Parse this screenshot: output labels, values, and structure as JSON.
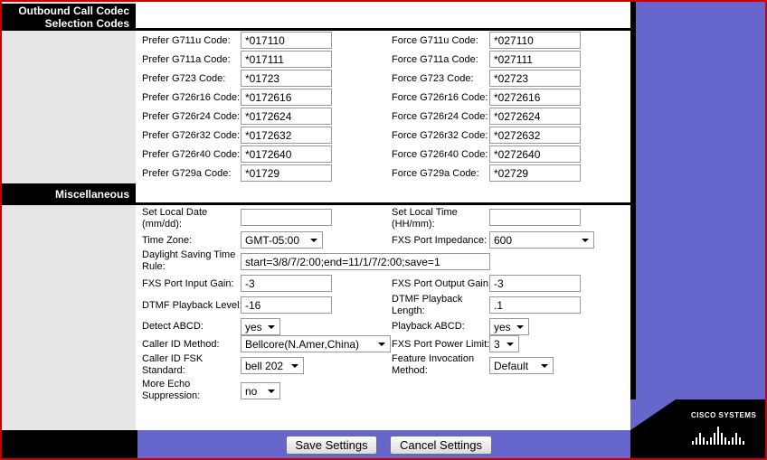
{
  "sections": {
    "codec_title_line1": "Outbound Call Codec",
    "codec_title_line2": "Selection Codes",
    "misc_title": "Miscellaneous"
  },
  "codec": {
    "prefer": [
      {
        "label": "Prefer G711u Code:",
        "value": "*017110"
      },
      {
        "label": "Prefer G711a Code:",
        "value": "*017111"
      },
      {
        "label": "Prefer G723 Code:",
        "value": "*01723"
      },
      {
        "label": "Prefer G726r16 Code:",
        "value": "*0172616"
      },
      {
        "label": "Prefer G726r24 Code:",
        "value": "*0172624"
      },
      {
        "label": "Prefer G726r32 Code:",
        "value": "*0172632"
      },
      {
        "label": "Prefer G726r40 Code:",
        "value": "*0172640"
      },
      {
        "label": "Prefer G729a Code:",
        "value": "*01729"
      }
    ],
    "force": [
      {
        "label": "Force G711u Code:",
        "value": "*027110"
      },
      {
        "label": "Force G711a Code:",
        "value": "*027111"
      },
      {
        "label": "Force G723 Code:",
        "value": "*02723"
      },
      {
        "label": "Force G726r16 Code:",
        "value": "*0272616"
      },
      {
        "label": "Force G726r24 Code:",
        "value": "*0272624"
      },
      {
        "label": "Force G726r32 Code:",
        "value": "*0272632"
      },
      {
        "label": "Force G726r40 Code:",
        "value": "*0272640"
      },
      {
        "label": "Force G729a Code:",
        "value": "*02729"
      }
    ]
  },
  "misc": {
    "set_local_date": {
      "label1": "Set Local Date",
      "label2": "(mm/dd):",
      "value": ""
    },
    "set_local_time": {
      "label1": "Set Local Time",
      "label2": "(HH/mm):",
      "value": ""
    },
    "time_zone": {
      "label": "Time Zone:",
      "value": "GMT-05:00"
    },
    "fxs_port_impedance": {
      "label": "FXS Port Impedance:",
      "value": "600"
    },
    "daylight_saving": {
      "label1": "Daylight Saving Time",
      "label2": "Rule:",
      "value": "start=3/8/7/2:00;end=11/1/7/2:00;save=1"
    },
    "fxs_input_gain": {
      "label": "FXS Port Input Gain:",
      "value": "-3"
    },
    "fxs_output_gain": {
      "label": "FXS Port Output Gain:",
      "value": "-3"
    },
    "dtmf_playback_level": {
      "label": "DTMF Playback Level:",
      "value": "-16"
    },
    "dtmf_playback_length": {
      "label1": "DTMF Playback",
      "label2": "Length:",
      "value": ".1"
    },
    "detect_abcd": {
      "label": "Detect ABCD:",
      "value": "yes"
    },
    "playback_abcd": {
      "label": "Playback ABCD:",
      "value": "yes"
    },
    "caller_id_method": {
      "label": "Caller ID Method:",
      "value": "Bellcore(N.Amer,China)"
    },
    "fxs_power_limit": {
      "label": "FXS Port Power Limit:",
      "value": "3"
    },
    "caller_id_fsk": {
      "label1": "Caller ID FSK",
      "label2": "Standard:",
      "value": "bell 202"
    },
    "feature_invocation": {
      "label1": "Feature Invocation",
      "label2": "Method:",
      "value": "Default"
    },
    "more_echo": {
      "label1": "More Echo",
      "label2": "Suppression:",
      "value": "no"
    }
  },
  "buttons": {
    "save": "Save Settings",
    "cancel": "Cancel Settings"
  },
  "logo": {
    "text": "Cisco Systems"
  },
  "colors": {
    "accent_purple": "#6666cc",
    "frame_red": "#cc0000",
    "header_black": "#000000",
    "sidebar_gray": "#e6e6e6"
  }
}
